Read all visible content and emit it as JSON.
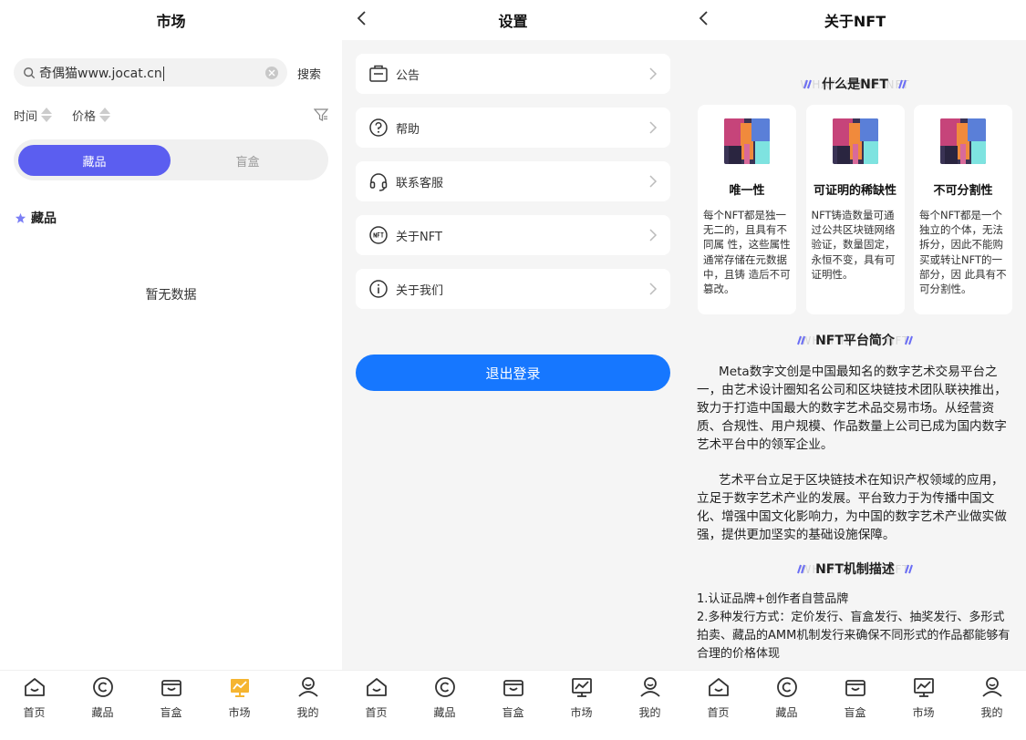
{
  "market": {
    "title": "市场",
    "search_value": "奇偶猫www.jocat.cn",
    "search_button": "搜索",
    "sort_time": "时间",
    "sort_price": "价格",
    "tab_active": "藏品",
    "tab_inactive": "盲盒",
    "section_label": "藏品",
    "empty_text": "暂无数据"
  },
  "settings": {
    "title": "设置",
    "items": [
      {
        "label": "公告",
        "icon": "announcement-icon"
      },
      {
        "label": "帮助",
        "icon": "help-icon"
      },
      {
        "label": "联系客服",
        "icon": "headset-icon"
      },
      {
        "label": "关于NFT",
        "icon": "nft-icon"
      },
      {
        "label": "关于我们",
        "icon": "info-icon"
      }
    ],
    "logout": "退出登录"
  },
  "about": {
    "title": "关于NFT",
    "sections": [
      {
        "title": "什么是NFT",
        "ghost": "WHAT IS THE NFT"
      },
      {
        "title": "NFT平台简介",
        "ghost": "WHAT IS THE NFT"
      },
      {
        "title": "NFT机制描述",
        "ghost": "WHAT IS THE NFT"
      }
    ],
    "cards": [
      {
        "title": "唯一性",
        "desc": "每个NFT都是独一无二的，且具有不同属 性，这些属性通常存储在元数据中，且铸 造后不可篡改。"
      },
      {
        "title": "可证明的稀缺性",
        "desc": "NFT铸造数量可通过公共区块链网络验证，数量固定，永恒不变，具有可证明性。"
      },
      {
        "title": "不可分割性",
        "desc": "每个NFT都是一个独立的个体，无法拆分，因此不能购买或转让NFT的一部分，因 此具有不可分割性。"
      }
    ],
    "para1": "Meta数字文创是中国最知名的数字艺术交易平台之一，由艺术设计圈知名公司和区块链技术团队联袂推出，致力于打造中国最大的数字艺术品交易市场。从经营资质、合规性、用户规模、作品数量上公司已成为国内数字艺术平台中的领军企业。",
    "para2": "艺术平台立足于区块链技术在知识产权领域的应用，立足于数字艺术产业的发展。平台致力于为传播中国文化、增强中国文化影响力，为中国的数字艺术产业做实做强，提供更加坚实的基础设施保障。",
    "list1": "1.认证品牌+创作者自营品牌",
    "list2": "2.多种发行方式：定价发行、盲盒发行、抽奖发行、多形式拍卖、藏品的AMM机制发行来确保不同形式的作品都能够有合理的价格体现"
  },
  "tabbar": {
    "home": "首页",
    "collection": "藏品",
    "blindbox": "盲盒",
    "market": "市场",
    "mine": "我的"
  },
  "colors": {
    "accent_purple": "#5b5ef0",
    "primary_blue": "#1677ff",
    "active_tab": "#f5b531"
  }
}
